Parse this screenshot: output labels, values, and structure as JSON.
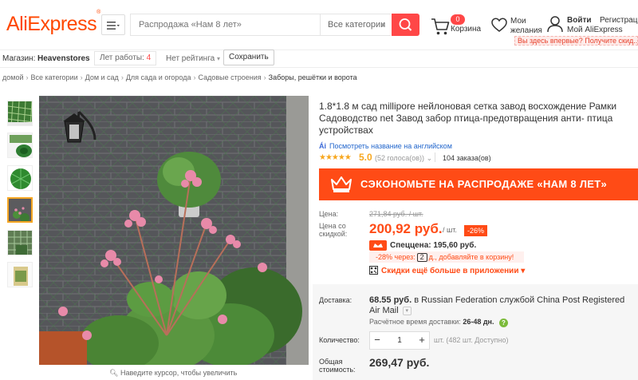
{
  "header": {
    "logo": "AliExpress",
    "logo_mark": "®",
    "search_placeholder": "Распродажа «Нам 8 лет»",
    "category_select": "Все категории",
    "cart_count": "0",
    "cart_label": "Корзина",
    "wishlist_label_1": "Мои",
    "wishlist_label_2": "желания",
    "login": "Войти",
    "register": "Регистрация",
    "my_account": "Мой AliExpress",
    "first_time_tip": "Вы здесь впервые? Получите скид...",
    "accent_color": "#ff4747"
  },
  "store": {
    "label": "Магазин:",
    "name": "Heavenstores",
    "years_text": "Лет работы:",
    "years_value": "4",
    "rating": "Нет рейтинга",
    "save": "Сохранить"
  },
  "breadcrumb": [
    "домой",
    "Все категории",
    "Дом и сад",
    "Для сада и огорода",
    "Садовые строения",
    "Заборы, решётки и ворота"
  ],
  "gallery": {
    "zoom_hint": "Наведите курсор, чтобы увеличить",
    "thumbnails": [
      "green-net-closeup",
      "rolled-net",
      "green-net-roll",
      "net-with-begonias",
      "net-on-wall",
      "packaged-net"
    ],
    "active_thumbnail": 3
  },
  "product": {
    "title": "1.8*1.8 м сад millipore нейлоновая сетка завод восхождение Рамки Садоводство net Завод забор птица-предотвращения анти- птица устройствах",
    "translate_icon": "Ái",
    "translate_link": "Посмотреть название на английском",
    "stars": "★★★★★",
    "score": "5.0",
    "votes": "(52 голоса(ов))",
    "orders": "104 заказа(ов)",
    "sale_banner": "СЭКОНОМЬТЕ НА РАСПРОДАЖЕ «НАМ 8 ЛЕТ»",
    "price_label": "Цена:",
    "old_price": "271,84 руб. / шт.",
    "discount_label_1": "Цена со",
    "discount_label_2": "скидкой:",
    "price": "200,92 руб.",
    "unit": "/ шт.",
    "discount_badge": "-26%",
    "special_price": "Спеццена: 195,60 руб.",
    "promo_text_1": "-28% через:",
    "promo_days": "2",
    "promo_text_2": "д., добавляйте в корзину!",
    "app_deal": "Скидки ещё больше в приложении",
    "app_deal_chevron": "▾",
    "shipping_label": "Доставка:",
    "shipping_price": "68.55 руб.",
    "shipping_text": "в Russian Federation службой China Post Registered Air Mail",
    "delivery_label": "Расчётное время доставки:",
    "delivery_days": "26-48 дн.",
    "qty_label": "Количество:",
    "qty_minus": "−",
    "qty_value": "1",
    "qty_plus": "+",
    "qty_available": "шт. (482 шт. Доступно)",
    "total_label_1": "Общая",
    "total_label_2": "стоимость:",
    "total": "269,47 руб."
  }
}
